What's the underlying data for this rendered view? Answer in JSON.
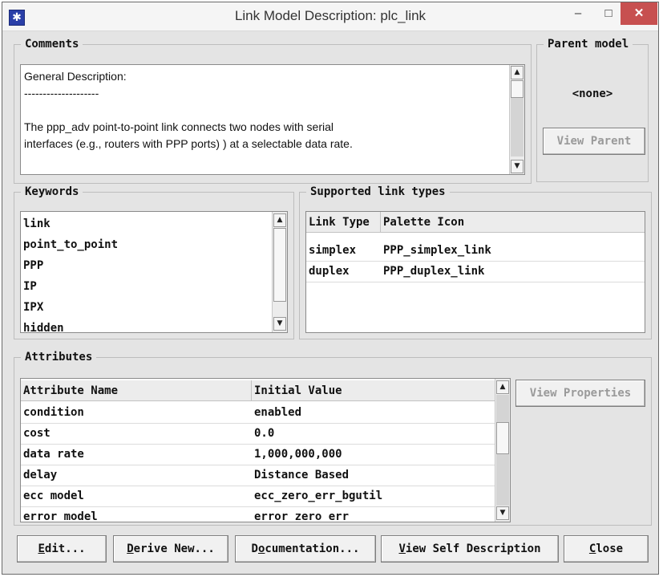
{
  "window": {
    "title": "Link Model Description: plc_link",
    "minimize_glyph": "–",
    "maximize_glyph": "□",
    "close_glyph": "✕",
    "app_icon": "star-icon"
  },
  "comments": {
    "label": "Comments",
    "lines": [
      "General Description:",
      "--------------------",
      "",
      "The ppp_adv point-to-point link connects two nodes with serial",
      "interfaces (e.g., routers with PPP ports) ) at a selectable data rate."
    ]
  },
  "parent_model": {
    "label": "Parent model",
    "value": "<none>",
    "view_parent_button": "View Parent"
  },
  "keywords": {
    "label": "Keywords",
    "items": [
      "link",
      "point_to_point",
      "PPP",
      "IP",
      "IPX",
      "hidden"
    ]
  },
  "supported_link_types": {
    "label": "Supported link types",
    "columns": [
      "Link Type",
      "Palette Icon"
    ],
    "rows": [
      [
        "simplex",
        "PPP_simplex_link"
      ],
      [
        "duplex",
        "PPP_duplex_link"
      ]
    ]
  },
  "attributes": {
    "label": "Attributes",
    "columns": [
      "Attribute Name",
      "Initial Value"
    ],
    "rows": [
      [
        "condition",
        "enabled"
      ],
      [
        "cost",
        "0.0"
      ],
      [
        "data rate",
        "1,000,000,000"
      ],
      [
        "delay",
        "Distance Based"
      ],
      [
        "ecc model",
        "ecc_zero_err_bgutil"
      ],
      [
        "error model",
        "error_zero_err"
      ]
    ],
    "view_properties_button": "View Properties"
  },
  "buttons": {
    "edit": {
      "underline": "E",
      "rest": "dit..."
    },
    "derive_new": {
      "underline": "D",
      "rest": "erive New..."
    },
    "documentation": {
      "pre": "D",
      "underline": "o",
      "rest": "cumentation..."
    },
    "view_self": {
      "underline": "V",
      "rest": "iew Self Description"
    },
    "close": {
      "underline": "C",
      "rest": "lose"
    }
  }
}
